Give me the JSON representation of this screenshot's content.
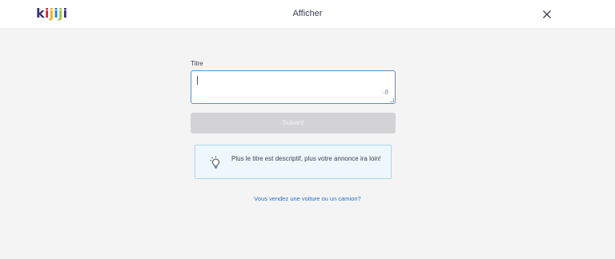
{
  "header": {
    "logo": [
      "k",
      "i",
      "j",
      "i",
      "j",
      "i"
    ],
    "logo_colors": [
      "#373373",
      "#e4222e",
      "#f8aa17",
      "#2681db",
      "#9bc54d",
      "#373373"
    ],
    "title": "Afficher",
    "close_icon": "close-icon"
  },
  "form": {
    "title_label": "Titre",
    "title_value": "",
    "char_counter": "-8",
    "next_button": "Suivant",
    "next_button_disabled": true
  },
  "tip": {
    "icon": "lightbulb-icon",
    "text": "Plus le titre est descriptif, plus votre annonce ira loin!"
  },
  "link": {
    "text": "Vous vendez une voiture ou un camion?"
  }
}
